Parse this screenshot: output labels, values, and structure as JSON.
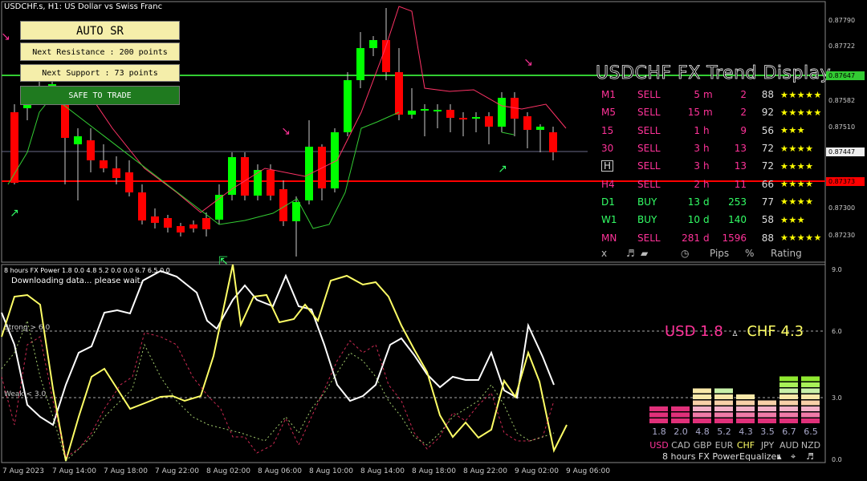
{
  "window_title": "USDCHF.s, H1:  US Dollar vs Swiss Franc",
  "auto_sr": {
    "title": "AUTO SR",
    "next_resistance": "Next Resistance : 200 points",
    "next_support": "Next Support : 73 points",
    "status": "SAFE TO TRADE"
  },
  "trend_display": {
    "title": "USDCHF FX Trend Display",
    "rows": [
      {
        "tf": "M1",
        "signal": "SELL",
        "time": "5",
        "unit": "m",
        "pips": "2",
        "pct": "88",
        "rating": "★★★★★"
      },
      {
        "tf": "M5",
        "signal": "SELL",
        "time": "15",
        "unit": "m",
        "pips": "2",
        "pct": "92",
        "rating": "★★★★★"
      },
      {
        "tf": "15",
        "signal": "SELL",
        "time": "1",
        "unit": "h",
        "pips": "9",
        "pct": "56",
        "rating": "★★★"
      },
      {
        "tf": "30",
        "signal": "SELL",
        "time": "3",
        "unit": "h",
        "pips": "13",
        "pct": "72",
        "rating": "★★★★"
      },
      {
        "tf": "H",
        "signal": "SELL",
        "time": "3",
        "unit": "h",
        "pips": "13",
        "pct": "72",
        "rating": "★★★★"
      },
      {
        "tf": "H4",
        "signal": "SELL",
        "time": "2",
        "unit": "h",
        "pips": "11",
        "pct": "66",
        "rating": "★★★★"
      },
      {
        "tf": "D1",
        "signal": "BUY",
        "time": "13",
        "unit": "d",
        "pips": "253",
        "pct": "77",
        "rating": "★★★★"
      },
      {
        "tf": "W1",
        "signal": "BUY",
        "time": "10",
        "unit": "d",
        "pips": "140",
        "pct": "58",
        "rating": "★★★"
      },
      {
        "tf": "MN",
        "signal": "SELL",
        "time": "281",
        "unit": "d",
        "pips": "1596",
        "pct": "88",
        "rating": "★★★★★"
      }
    ],
    "header": {
      "close": "x",
      "sound": "♬",
      "pips": "Pips",
      "pct": "%",
      "rating": "Rating"
    }
  },
  "price_axis": [
    "0.87790",
    "0.87722",
    "0.87647",
    "0.87582",
    "0.87510",
    "0.87447",
    "0.87373",
    "0.87300",
    "0.87230"
  ],
  "price_tags": {
    "resistance": "0.87647",
    "current": "0.87447",
    "support": "0.87373"
  },
  "time_axis": [
    "7 Aug 2023",
    "7 Aug 14:00",
    "7 Aug 18:00",
    "7 Aug 22:00",
    "8 Aug 02:00",
    "8 Aug 06:00",
    "8 Aug 10:00",
    "8 Aug 14:00",
    "8 Aug 18:00",
    "8 Aug 22:00",
    "9 Aug 02:00",
    "9 Aug 06:00"
  ],
  "indicator": {
    "title": "8 hours FX Power 1.8 0.0 4.8 5.2 0.0 0.0 6.7 6.5 0.0",
    "status": "Downloading data... please wait.",
    "strong_label": "Strong > 6.0",
    "weak_label": "Weak < 3.0",
    "axis": [
      "9.0",
      "6.0",
      "3.0",
      "0.0"
    ],
    "usd_label": "USD 1.8",
    "chf_label": "CHF 4.3",
    "delta": "▵",
    "equalizer": {
      "values": [
        "1.8",
        "2.0",
        "4.8",
        "5.2",
        "4.3",
        "3.5",
        "6.7",
        "6.5"
      ],
      "currencies": [
        "USD",
        "CAD",
        "GBP",
        "EUR",
        "CHF",
        "JPY",
        "AUD",
        "NZD"
      ],
      "levels": [
        1.8,
        2.0,
        4.8,
        5.2,
        4.3,
        3.5,
        6.7,
        6.5
      ]
    },
    "footer": {
      "period": "8 hours",
      "name": "FX Power",
      "eq": "Equalizer"
    }
  },
  "colors": {
    "bull": "#00ff00",
    "bear": "#ff0000",
    "usd": "#ff3399",
    "chf": "#ffff66",
    "resistance_line": "#33cc33",
    "support_line": "#ff0000"
  }
}
